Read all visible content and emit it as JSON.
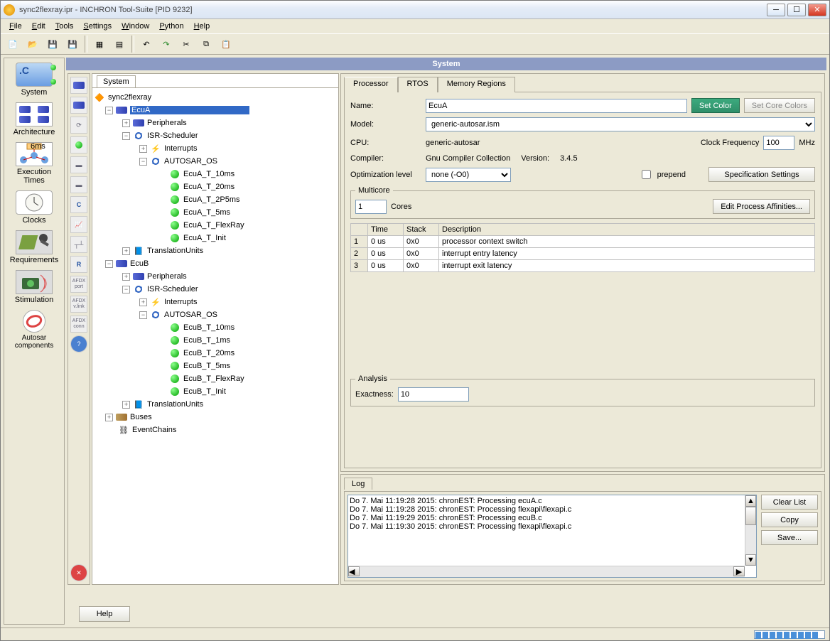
{
  "window": {
    "title": "sync2flexray.ipr - INCHRON Tool-Suite [PID 9232]"
  },
  "menu": [
    "File",
    "Edit",
    "Tools",
    "Settings",
    "Window",
    "Python",
    "Help"
  ],
  "leftnav": [
    {
      "label": "System"
    },
    {
      "label": "Architecture"
    },
    {
      "label": "Execution Times"
    },
    {
      "label": "Clocks"
    },
    {
      "label": "Requirements"
    },
    {
      "label": "Stimulation"
    },
    {
      "label": "Autosar components"
    }
  ],
  "system_header": "System",
  "tree_tab": "System",
  "tree_root": "sync2flexray",
  "ecua": {
    "name": "EcuA",
    "peripherals": "Peripherals",
    "isr": "ISR-Scheduler",
    "interrupts": "Interrupts",
    "os": "AUTOSAR_OS",
    "tasks": [
      "EcuA_T_10ms",
      "EcuA_T_20ms",
      "EcuA_T_2P5ms",
      "EcuA_T_5ms",
      "EcuA_T_FlexRay",
      "EcuA_T_Init"
    ],
    "tu": "TranslationUnits"
  },
  "ecub": {
    "name": "EcuB",
    "peripherals": "Peripherals",
    "isr": "ISR-Scheduler",
    "interrupts": "Interrupts",
    "os": "AUTOSAR_OS",
    "tasks": [
      "EcuB_T_10ms",
      "EcuB_T_1ms",
      "EcuB_T_20ms",
      "EcuB_T_5ms",
      "EcuB_T_FlexRay",
      "EcuB_T_Init"
    ],
    "tu": "TranslationUnits"
  },
  "tree_extra": [
    "Buses",
    "EventChains"
  ],
  "prop": {
    "tabs": [
      "Processor",
      "RTOS",
      "Memory Regions"
    ],
    "name_lbl": "Name:",
    "name_val": "EcuA",
    "setcolor": "Set Color",
    "setcorecolors": "Set Core Colors",
    "model_lbl": "Model:",
    "model_val": "generic-autosar.ism",
    "cpu_lbl": "CPU:",
    "cpu_val": "generic-autosar",
    "clockfreq_lbl": "Clock Frequency",
    "clockfreq_val": "100",
    "clockfreq_unit": "MHz",
    "compiler_lbl": "Compiler:",
    "compiler_val": "Gnu Compiler Collection",
    "version_lbl": "Version:",
    "version_val": "3.4.5",
    "optlvl_lbl": "Optimization level",
    "optlvl_val": "none (-O0)",
    "prepend_lbl": "prepend",
    "spec_btn": "Specification Settings",
    "multicore_lbl": "Multicore",
    "cores_val": "1",
    "cores_lbl": "Cores",
    "editaff": "Edit Process Affinities...",
    "grid_headers": [
      "",
      "Time",
      "Stack",
      "Description"
    ],
    "grid_rows": [
      {
        "n": "1",
        "time": "0 us",
        "stack": "0x0",
        "desc": "processor context switch"
      },
      {
        "n": "2",
        "time": "0 us",
        "stack": "0x0",
        "desc": "interrupt entry latency"
      },
      {
        "n": "3",
        "time": "0 us",
        "stack": "0x0",
        "desc": "interrupt exit latency"
      }
    ],
    "analysis_lbl": "Analysis",
    "exact_lbl": "Exactness:",
    "exact_val": "10"
  },
  "log": {
    "tab": "Log",
    "lines": [
      "Do 7. Mai 11:19:28 2015:  chronEST: Processing  ecuA.c",
      "Do 7. Mai 11:19:28 2015:  chronEST: Processing  flexapi\\flexapi.c",
      "Do 7. Mai 11:19:29 2015:  chronEST: Processing  ecuB.c",
      "Do 7. Mai 11:19:30 2015:  chronEST: Processing  flexapi\\flexapi.c"
    ],
    "btns": [
      "Clear List",
      "Copy",
      "Save..."
    ]
  },
  "help_btn": "Help",
  "sidebar_labels": {
    "afdx_port": "AFDX\nport",
    "afdx_vlink": "AFDX\nv.link",
    "afdx_conn": "AFDX\nconn"
  }
}
